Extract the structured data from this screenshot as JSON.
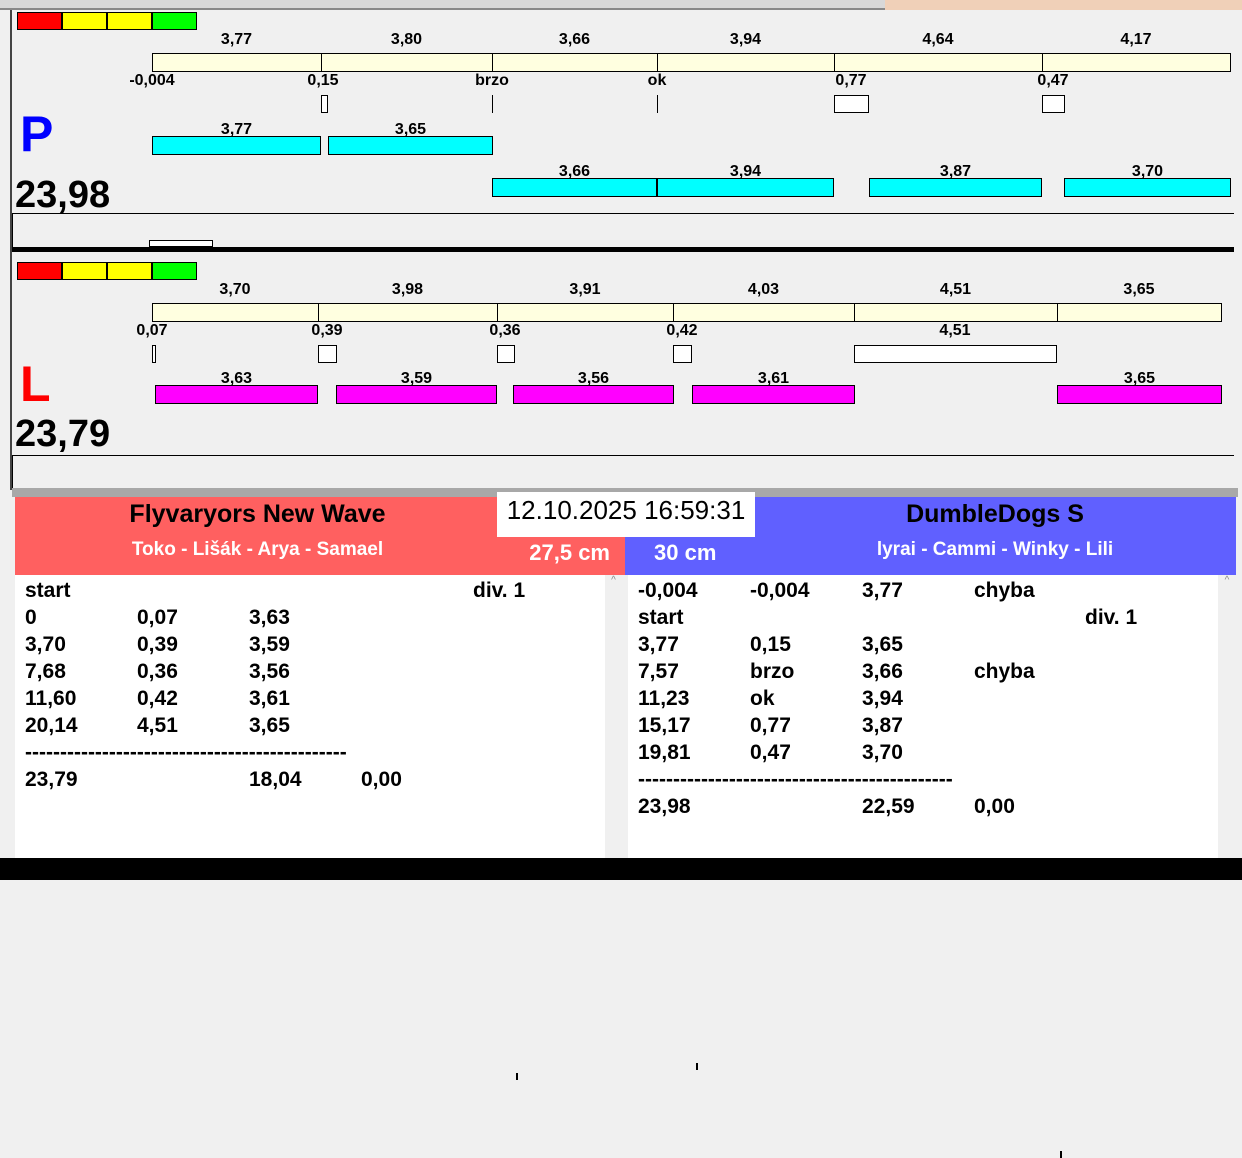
{
  "colors": {
    "red": "#ff0000",
    "yellow": "#ffff00",
    "green": "#00ff00",
    "cream": "#ffffe0",
    "cyan": "#00ffff",
    "magenta": "#ff00ff",
    "team_left": "#ff6060",
    "team_right": "#6060ff"
  },
  "panel_p": {
    "letter": "P",
    "total": "23,98",
    "segments": [
      "3,77",
      "3,80",
      "3,66",
      "3,94",
      "4,64",
      "4,17"
    ],
    "marks": [
      "-0,004",
      "0,15",
      "brzo",
      "ok",
      "0,77",
      "0,47"
    ],
    "runs": [
      "3,77",
      "3,65",
      "3,66",
      "3,94",
      "3,87",
      "3,70"
    ]
  },
  "panel_l": {
    "letter": "L",
    "total": "23,79",
    "segments": [
      "3,70",
      "3,98",
      "3,91",
      "4,03",
      "4,51",
      "3,65"
    ],
    "marks": [
      "0,07",
      "0,39",
      "0,36",
      "0,42",
      "4,51"
    ],
    "runs": [
      "3,63",
      "3,59",
      "3,56",
      "3,61",
      "3,65"
    ]
  },
  "datetime": "12.10.2025 16:59:31",
  "team_left": {
    "name": "Flyvaryors New Wave",
    "members": "Toko - Lišák - Arya - Samael",
    "height": "27,5 cm",
    "rows": [
      [
        "start",
        "",
        "",
        "",
        "div.  1"
      ],
      [
        "0",
        "0,07",
        "3,63",
        "",
        ""
      ],
      [
        "3,70",
        "0,39",
        "3,59",
        "",
        ""
      ],
      [
        "7,68",
        "0,36",
        "3,56",
        "",
        ""
      ],
      [
        "11,60",
        "0,42",
        "3,61",
        "",
        ""
      ],
      [
        "20,14",
        "4,51",
        "3,65",
        "",
        ""
      ],
      [
        "----------------------------------------------",
        "",
        "",
        "",
        ""
      ],
      [
        "23,79",
        "",
        "18,04",
        "0,00",
        ""
      ]
    ]
  },
  "team_right": {
    "name": "DumbleDogs S",
    "members": "lyrai - Cammi - Winky - Lili",
    "height": "30 cm",
    "rows": [
      [
        "-0,004",
        "-0,004",
        "3,77",
        "chyba",
        ""
      ],
      [
        "start",
        "",
        "",
        "",
        "div.  1"
      ],
      [
        "3,77",
        "0,15",
        "3,65",
        "",
        ""
      ],
      [
        "7,57",
        "brzo",
        "3,66",
        "chyba",
        ""
      ],
      [
        "11,23",
        "ok",
        "3,94",
        "",
        ""
      ],
      [
        "15,17",
        "0,77",
        "3,87",
        "",
        ""
      ],
      [
        "19,81",
        "0,47",
        "3,70",
        "",
        ""
      ],
      [
        "---------------------------------------------",
        "",
        "",
        "",
        ""
      ],
      [
        "23,98",
        "",
        "22,59",
        "0,00",
        ""
      ]
    ]
  }
}
